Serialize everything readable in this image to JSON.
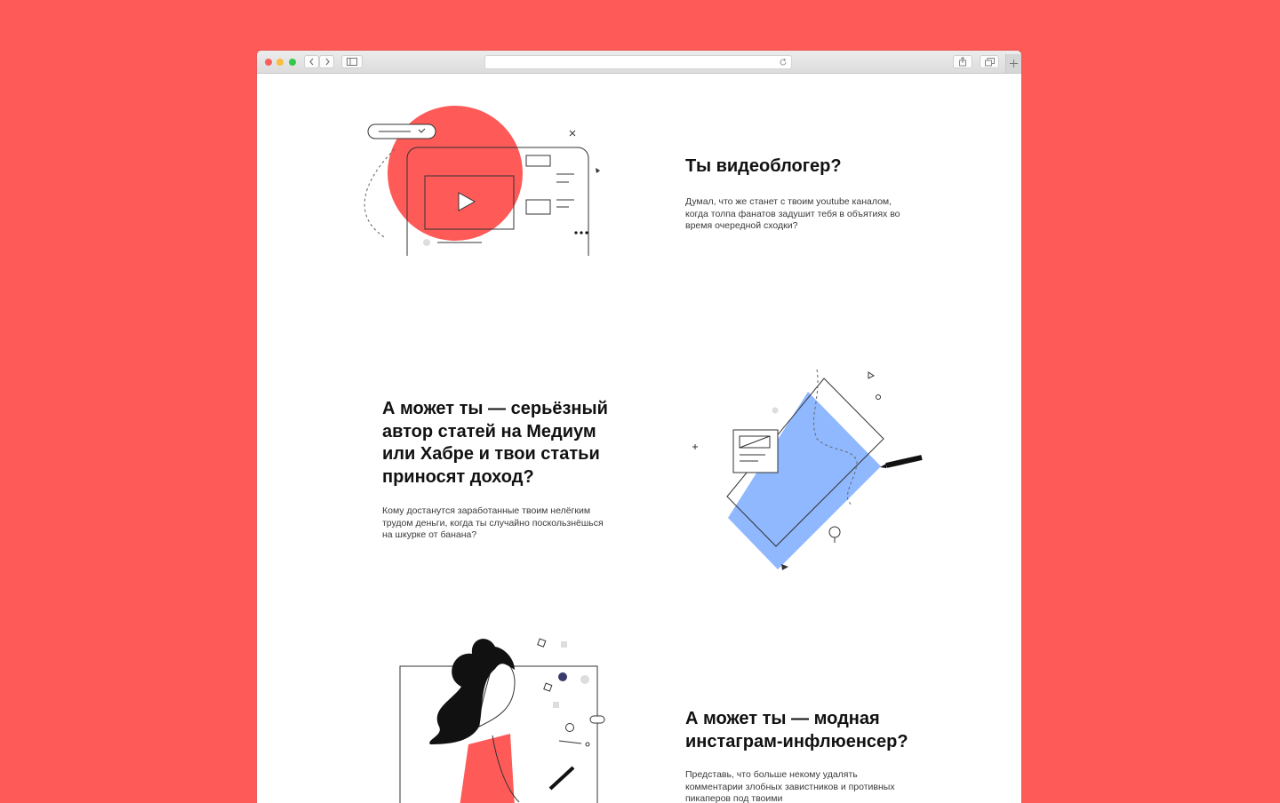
{
  "browser": {
    "address_value": "",
    "icons": {
      "back": "chevron-left-icon",
      "forward": "chevron-right-icon",
      "sidebar": "sidebar-icon",
      "reload": "reload-icon",
      "share": "share-icon",
      "tabs": "tabs-icon",
      "new_tab": "plus-icon"
    }
  },
  "sections": [
    {
      "title": "Ты видеоблогер?",
      "text": "Думал, что же станет с твоим youtube каналом, когда толпа фанатов задушит тебя в объятиях во время очередной сходки?"
    },
    {
      "title": "А может ты — серьёзный автор статей на Медиум или Хабре и твои статьи приносят доход?",
      "text": "Кому достанутся заработанные твоим нелёгким трудом деньги, когда ты случайно поскользнёшься на шкурке от банана?"
    },
    {
      "title": "А может ты — модная инстаграм-инфлюенсер?",
      "text": "Представь, что больше некому удалять комментарии злобных завистников и противных пикаперов под твоими"
    }
  ],
  "colors": {
    "background": "#fd5a58",
    "accent_red": "#fd5a58",
    "accent_blue": "#8fb8fe",
    "text": "#111111"
  }
}
